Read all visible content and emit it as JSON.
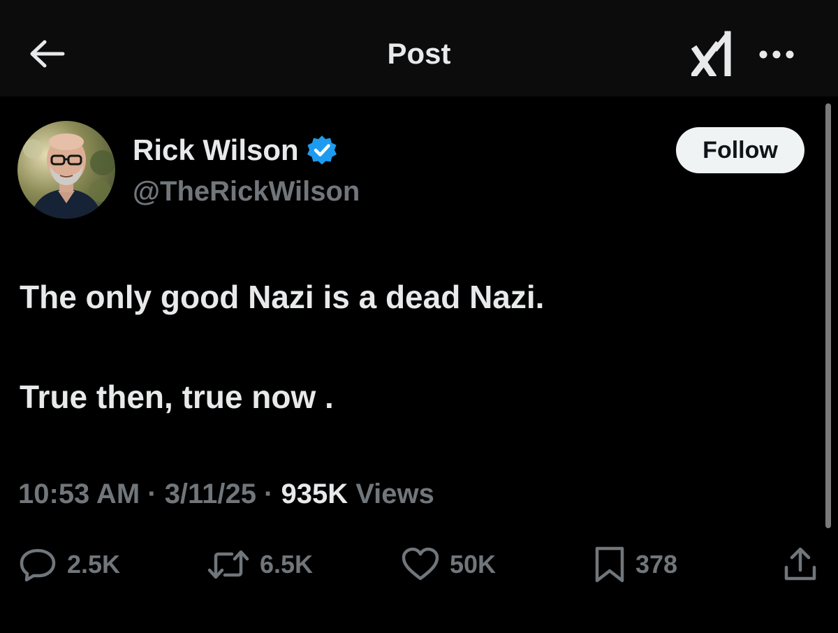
{
  "header": {
    "title": "Post",
    "back_icon": "arrow-left-icon",
    "grok_icon": "grok-logo-icon",
    "more_icon": "more-horizontal-icon"
  },
  "author": {
    "display_name": "Rick Wilson",
    "handle": "@TheRickWilson",
    "verified": true,
    "verified_color": "#1d9bf0",
    "follow_label": "Follow"
  },
  "post": {
    "lines": [
      "The only good Nazi is a dead Nazi.",
      "True then, true now ."
    ]
  },
  "meta": {
    "time": "10:53 AM",
    "separator": " · ",
    "date": "3/11/25",
    "views_count": "935K",
    "views_label": " Views"
  },
  "actions": {
    "replies": "2.5K",
    "reposts": "6.5K",
    "likes": "50K",
    "bookmarks": "378"
  },
  "colors": {
    "background": "#000000",
    "primary_text": "#e7e9ea",
    "secondary_text": "#71767b",
    "accent": "#1d9bf0"
  }
}
